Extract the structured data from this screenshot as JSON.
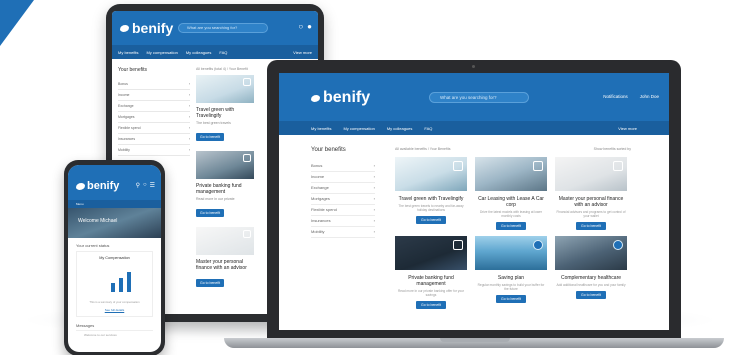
{
  "brand": {
    "name": "benify",
    "primary_color": "#1f6fb6",
    "nav_color": "#1a5f9e"
  },
  "tablet": {
    "search_placeholder": "What are you searching for?",
    "nav": [
      "My benefits",
      "My compensation",
      "My colleagues",
      "FAQ"
    ],
    "nav_more": "View more",
    "sidebar_title": "Your benefits",
    "sidebar_items": [
      "Bonus",
      "Income",
      "Exchange",
      "Mortgages",
      "Flexible spend",
      "Insurances",
      "Mobility"
    ],
    "crumb": "All benefits (total 4) / Your Benefit",
    "cards": [
      {
        "title": "Travel green with Travelingify",
        "desc": "The best green travels",
        "button": "Go to benefit"
      },
      {
        "title": "Private banking fund management",
        "desc": "Read more in our private",
        "button": "Go to benefit"
      },
      {
        "title": "Master your personal finance with an advisor",
        "desc": "",
        "button": "Go to benefit"
      }
    ]
  },
  "laptop": {
    "search_placeholder": "What are you searching for?",
    "header_right": [
      "Notifications",
      "John Doe"
    ],
    "nav": [
      "My benefits",
      "My compensation",
      "My colleagues",
      "FAQ"
    ],
    "nav_more": "View more",
    "sidebar_title": "Your benefits",
    "sidebar_items": [
      "Bonus",
      "Income",
      "Exchange",
      "Mortgages",
      "Flexible spend",
      "Insurances",
      "Mobility"
    ],
    "crumb_left": "All available benefits / Your Benefits",
    "crumb_right": "Show benefits sorted by",
    "cards": [
      {
        "title": "Travel green with Travelingify",
        "desc": "The best green travels to nearby and far-away holiday destinations",
        "button": "Go to benefit"
      },
      {
        "title": "Car Leasing with Lease A Car corp",
        "desc": "Drive the latest models with leasing at lower monthly costs",
        "button": "Go to benefit"
      },
      {
        "title": "Master your personal finance with an advisor",
        "desc": "Financial advisors and programs to get control of your wallet",
        "button": "Go to benefit"
      },
      {
        "title": "Private banking fund management",
        "desc": "Read more in our private banking offer for your savings",
        "button": "Go to benefit"
      },
      {
        "title": "Saving plan",
        "desc": "Regular monthly savings to build your buffer for the future",
        "button": "Go to benefit"
      },
      {
        "title": "Complementary healthcare",
        "desc": "Add additional healthcare for you and your family",
        "button": "Go to benefit"
      }
    ]
  },
  "phone": {
    "subnav": "Menu",
    "hero": "Welcome Michael",
    "section": "Your current status",
    "comp_title": "My Compensation",
    "comp_bar_levels": [
      0.35,
      0.55,
      0.75
    ],
    "comp_note": "This is a summary of your compensation",
    "comp_link": "See full details",
    "messages_title": "Messages",
    "messages_row": "Welcome to our services"
  }
}
